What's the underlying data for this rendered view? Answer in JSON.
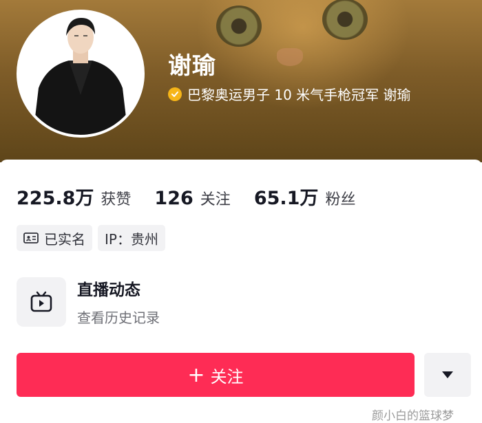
{
  "profile": {
    "name": "谢瑜",
    "verification": "巴黎奥运男子 10 米气手枪冠军 谢瑜"
  },
  "stats": [
    {
      "value": "225.8万",
      "label": "获赞"
    },
    {
      "value": "126",
      "label": "关注"
    },
    {
      "value": "65.1万",
      "label": "粉丝"
    }
  ],
  "tags": {
    "real_name": "已实名",
    "ip": "IP：贵州"
  },
  "live": {
    "title": "直播动态",
    "subtitle": "查看历史记录"
  },
  "actions": {
    "follow_plus": "+",
    "follow_label": "关注"
  },
  "watermark": "颜小白的篮球梦",
  "icons": {
    "verify": "verified-badge-icon",
    "id_card": "id-card-icon",
    "live": "tv-icon",
    "more": "triangle-down-icon"
  },
  "colors": {
    "accent": "#fe2c55",
    "verify": "#f6b518"
  }
}
